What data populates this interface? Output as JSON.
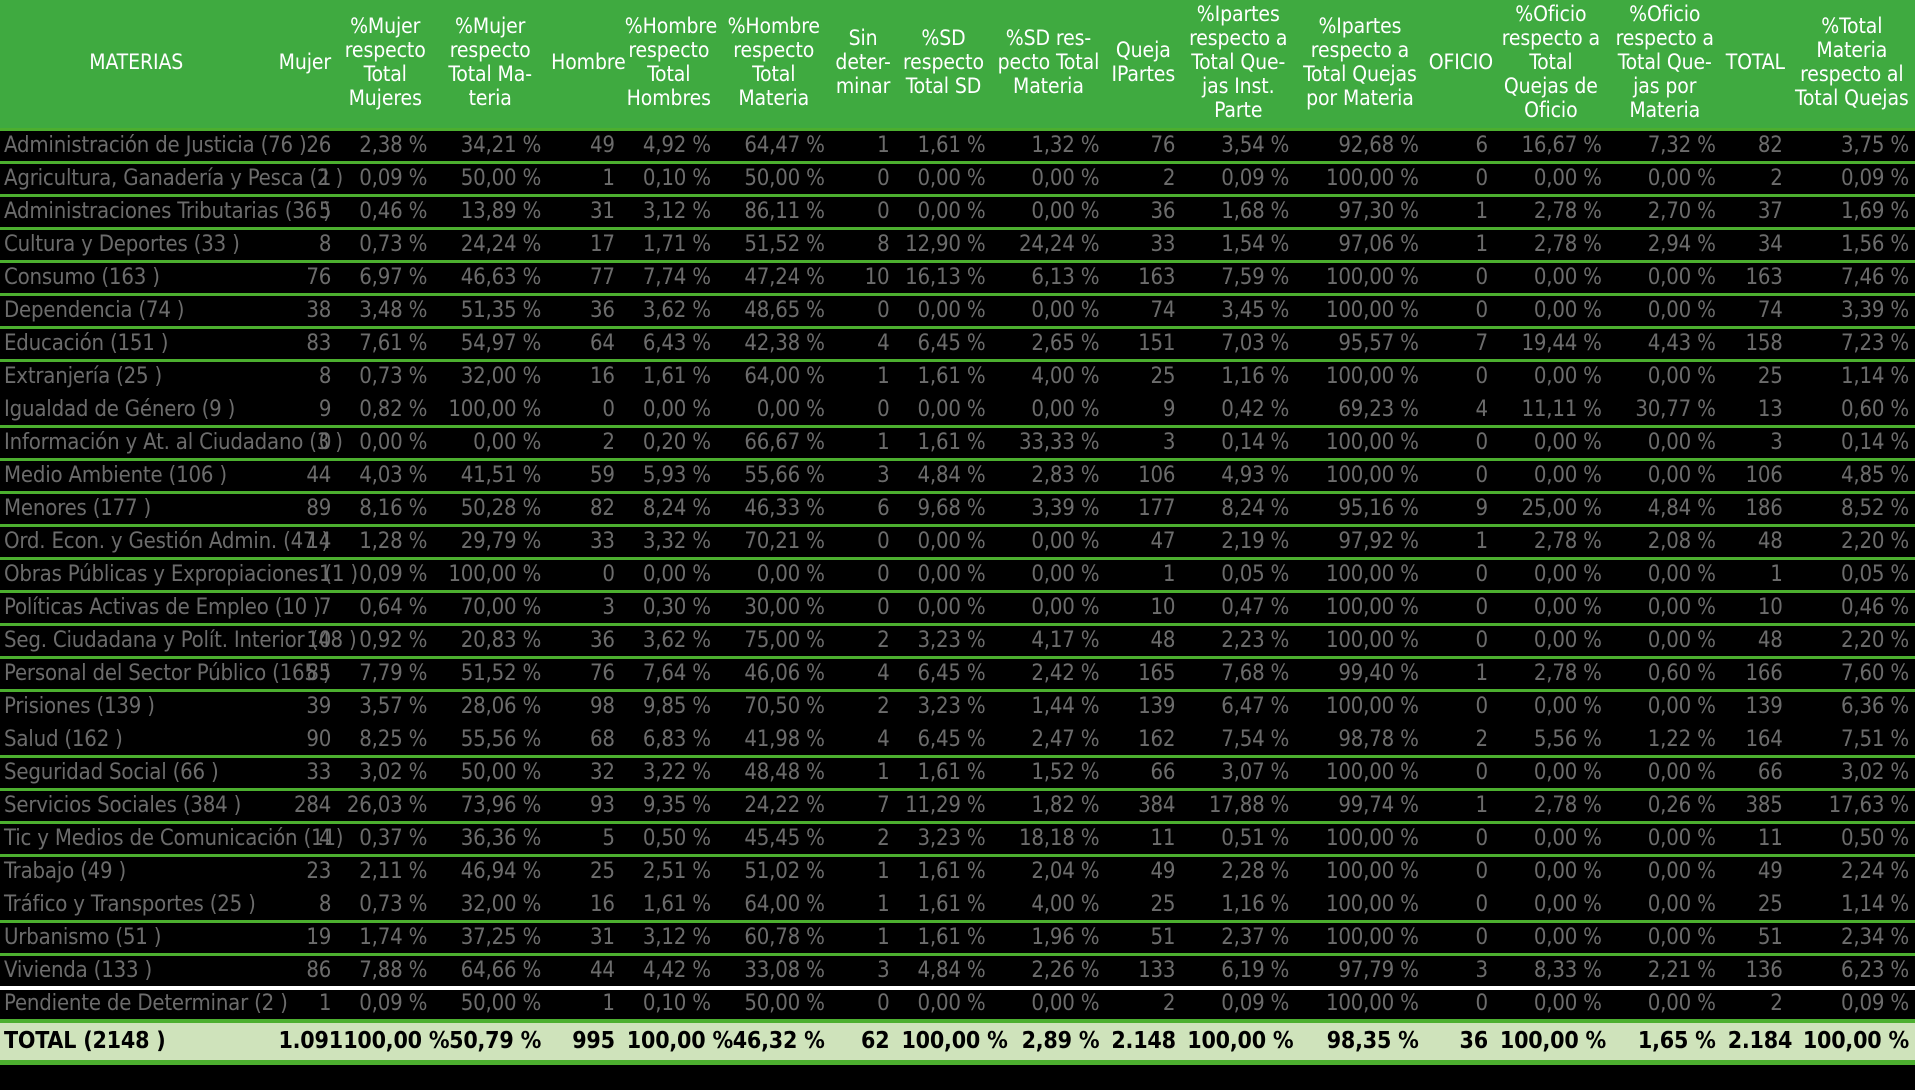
{
  "table": {
    "columns": [
      "MATERIAS",
      "Mujer",
      "%Mujer respecto Total Mujeres",
      "%Mujer respecto Total Ma-teria",
      "Hombre",
      "%Hombre respecto Total Hombres",
      "%Hombre respecto Total Materia",
      "Sin deter-minar",
      "%SD respecto Total SD",
      "%SD res-pecto Total Materia",
      "Queja IPartes",
      "%Ipartes respecto a Total Que-jas Inst. Parte",
      "%Ipartes respecto a Total Quejas por Materia",
      "OFICIO",
      "%Oficio respecto a Total Quejas de Oficio",
      "%Oficio respecto a Total Que-jas por Materia",
      "TOTAL",
      "%Total Materia respecto al Total Quejas"
    ],
    "rows": [
      [
        "Administración de Justicia (76 )",
        "26",
        "2,38 %",
        "34,21 %",
        "49",
        "4,92 %",
        "64,47 %",
        "1",
        "1,61 %",
        "1,32 %",
        "76",
        "3,54 %",
        "92,68 %",
        "6",
        "16,67 %",
        "7,32 %",
        "82",
        "3,75 %"
      ],
      [
        "Agricultura, Ganadería y Pesca (2 )",
        "1",
        "0,09 %",
        "50,00 %",
        "1",
        "0,10 %",
        "50,00 %",
        "0",
        "0,00 %",
        "0,00 %",
        "2",
        "0,09 %",
        "100,00 %",
        "0",
        "0,00 %",
        "0,00 %",
        "2",
        "0,09 %"
      ],
      [
        "Administraciones Tributarias (36 )",
        "5",
        "0,46 %",
        "13,89 %",
        "31",
        "3,12 %",
        "86,11 %",
        "0",
        "0,00 %",
        "0,00 %",
        "36",
        "1,68 %",
        "97,30 %",
        "1",
        "2,78 %",
        "2,70 %",
        "37",
        "1,69 %"
      ],
      [
        "Cultura y Deportes (33 )",
        "8",
        "0,73 %",
        "24,24 %",
        "17",
        "1,71 %",
        "51,52 %",
        "8",
        "12,90 %",
        "24,24 %",
        "33",
        "1,54 %",
        "97,06 %",
        "1",
        "2,78 %",
        "2,94 %",
        "34",
        "1,56 %"
      ],
      [
        "Consumo (163 )",
        "76",
        "6,97 %",
        "46,63 %",
        "77",
        "7,74 %",
        "47,24 %",
        "10",
        "16,13 %",
        "6,13 %",
        "163",
        "7,59 %",
        "100,00 %",
        "0",
        "0,00 %",
        "0,00 %",
        "163",
        "7,46 %"
      ],
      [
        "Dependencia (74 )",
        "38",
        "3,48 %",
        "51,35 %",
        "36",
        "3,62 %",
        "48,65 %",
        "0",
        "0,00 %",
        "0,00 %",
        "74",
        "3,45 %",
        "100,00 %",
        "0",
        "0,00 %",
        "0,00 %",
        "74",
        "3,39 %"
      ],
      [
        "Educación (151 )",
        "83",
        "7,61 %",
        "54,97 %",
        "64",
        "6,43 %",
        "42,38 %",
        "4",
        "6,45 %",
        "2,65 %",
        "151",
        "7,03 %",
        "95,57 %",
        "7",
        "19,44 %",
        "4,43 %",
        "158",
        "7,23 %"
      ],
      [
        "Extranjería (25 )",
        "8",
        "0,73 %",
        "32,00 %",
        "16",
        "1,61 %",
        "64,00 %",
        "1",
        "1,61 %",
        "4,00 %",
        "25",
        "1,16 %",
        "100,00 %",
        "0",
        "0,00 %",
        "0,00 %",
        "25",
        "1,14 %"
      ],
      [
        "Igualdad de Género (9 )",
        "9",
        "0,82 %",
        "100,00 %",
        "0",
        "0,00 %",
        "0,00 %",
        "0",
        "0,00 %",
        "0,00 %",
        "9",
        "0,42 %",
        "69,23 %",
        "4",
        "11,11 %",
        "30,77 %",
        "13",
        "0,60 %"
      ],
      [
        "Información y At. al Ciudadano (3 )",
        "0",
        "0,00 %",
        "0,00 %",
        "2",
        "0,20 %",
        "66,67 %",
        "1",
        "1,61 %",
        "33,33 %",
        "3",
        "0,14 %",
        "100,00 %",
        "0",
        "0,00 %",
        "0,00 %",
        "3",
        "0,14 %"
      ],
      [
        "Medio Ambiente (106 )",
        "44",
        "4,03 %",
        "41,51 %",
        "59",
        "5,93 %",
        "55,66 %",
        "3",
        "4,84 %",
        "2,83 %",
        "106",
        "4,93 %",
        "100,00 %",
        "0",
        "0,00 %",
        "0,00 %",
        "106",
        "4,85 %"
      ],
      [
        "Menores (177 )",
        "89",
        "8,16 %",
        "50,28 %",
        "82",
        "8,24 %",
        "46,33 %",
        "6",
        "9,68 %",
        "3,39 %",
        "177",
        "8,24 %",
        "95,16 %",
        "9",
        "25,00 %",
        "4,84 %",
        "186",
        "8,52 %"
      ],
      [
        "Ord. Econ. y Gestión Admin. (47 )",
        "14",
        "1,28 %",
        "29,79 %",
        "33",
        "3,32 %",
        "70,21 %",
        "0",
        "0,00 %",
        "0,00 %",
        "47",
        "2,19 %",
        "97,92 %",
        "1",
        "2,78 %",
        "2,08 %",
        "48",
        "2,20 %"
      ],
      [
        "Obras Públicas y Expropiaciones (1 )",
        "1",
        "0,09 %",
        "100,00 %",
        "0",
        "0,00 %",
        "0,00 %",
        "0",
        "0,00 %",
        "0,00 %",
        "1",
        "0,05 %",
        "100,00 %",
        "0",
        "0,00 %",
        "0,00 %",
        "1",
        "0,05 %"
      ],
      [
        "Políticas Activas de Empleo (10 )",
        "7",
        "0,64 %",
        "70,00 %",
        "3",
        "0,30 %",
        "30,00 %",
        "0",
        "0,00 %",
        "0,00 %",
        "10",
        "0,47 %",
        "100,00 %",
        "0",
        "0,00 %",
        "0,00 %",
        "10",
        "0,46 %"
      ],
      [
        "Seg. Ciudadana y Polít. Interior (48 )",
        "10",
        "0,92 %",
        "20,83 %",
        "36",
        "3,62 %",
        "75,00 %",
        "2",
        "3,23 %",
        "4,17 %",
        "48",
        "2,23 %",
        "100,00 %",
        "0",
        "0,00 %",
        "0,00 %",
        "48",
        "2,20 %"
      ],
      [
        "Personal del Sector Público (165 )",
        "85",
        "7,79 %",
        "51,52 %",
        "76",
        "7,64 %",
        "46,06 %",
        "4",
        "6,45 %",
        "2,42 %",
        "165",
        "7,68 %",
        "99,40 %",
        "1",
        "2,78 %",
        "0,60 %",
        "166",
        "7,60 %"
      ],
      [
        "Prisiones (139 )",
        "39",
        "3,57 %",
        "28,06 %",
        "98",
        "9,85 %",
        "70,50 %",
        "2",
        "3,23 %",
        "1,44 %",
        "139",
        "6,47 %",
        "100,00 %",
        "0",
        "0,00 %",
        "0,00 %",
        "139",
        "6,36 %"
      ],
      [
        "Salud (162 )",
        "90",
        "8,25 %",
        "55,56 %",
        "68",
        "6,83 %",
        "41,98 %",
        "4",
        "6,45 %",
        "2,47 %",
        "162",
        "7,54 %",
        "98,78 %",
        "2",
        "5,56 %",
        "1,22 %",
        "164",
        "7,51 %"
      ],
      [
        "Seguridad Social (66 )",
        "33",
        "3,02 %",
        "50,00 %",
        "32",
        "3,22 %",
        "48,48 %",
        "1",
        "1,61 %",
        "1,52 %",
        "66",
        "3,07 %",
        "100,00 %",
        "0",
        "0,00 %",
        "0,00 %",
        "66",
        "3,02 %"
      ],
      [
        "Servicios Sociales (384 )",
        "284",
        "26,03 %",
        "73,96 %",
        "93",
        "9,35 %",
        "24,22 %",
        "7",
        "11,29 %",
        "1,82 %",
        "384",
        "17,88 %",
        "99,74 %",
        "1",
        "2,78 %",
        "0,26 %",
        "385",
        "17,63 %"
      ],
      [
        "Tic y Medios de Comunicación (11)",
        "4",
        "0,37 %",
        "36,36 %",
        "5",
        "0,50 %",
        "45,45 %",
        "2",
        "3,23 %",
        "18,18 %",
        "11",
        "0,51 %",
        "100,00 %",
        "0",
        "0,00 %",
        "0,00 %",
        "11",
        "0,50 %"
      ],
      [
        "Trabajo (49 )",
        "23",
        "2,11 %",
        "46,94 %",
        "25",
        "2,51 %",
        "51,02 %",
        "1",
        "1,61 %",
        "2,04 %",
        "49",
        "2,28 %",
        "100,00 %",
        "0",
        "0,00 %",
        "0,00 %",
        "49",
        "2,24 %"
      ],
      [
        "Tráfico y Transportes (25 )",
        "8",
        "0,73 %",
        "32,00 %",
        "16",
        "1,61 %",
        "64,00 %",
        "1",
        "1,61 %",
        "4,00 %",
        "25",
        "1,16 %",
        "100,00 %",
        "0",
        "0,00 %",
        "0,00 %",
        "25",
        "1,14 %"
      ],
      [
        "Urbanismo (51 )",
        "19",
        "1,74 %",
        "37,25 %",
        "31",
        "3,12 %",
        "60,78 %",
        "1",
        "1,61 %",
        "1,96 %",
        "51",
        "2,37 %",
        "100,00 %",
        "0",
        "0,00 %",
        "0,00 %",
        "51",
        "2,34 %"
      ],
      [
        "Vivienda (133 )",
        "86",
        "7,88 %",
        "64,66 %",
        "44",
        "4,42 %",
        "33,08 %",
        "3",
        "4,84 %",
        "2,26 %",
        "133",
        "6,19 %",
        "97,79 %",
        "3",
        "8,33 %",
        "2,21 %",
        "136",
        "6,23 %"
      ],
      [
        "Pendiente de Determinar (2 )",
        "1",
        "0,09 %",
        "50,00 %",
        "1",
        "0,10 %",
        "50,00 %",
        "0",
        "0,00 %",
        "0,00 %",
        "2",
        "0,09 %",
        "100,00 %",
        "0",
        "0,00 %",
        "0,00 %",
        "2",
        "0,09 %"
      ]
    ],
    "total_row": [
      "TOTAL (2148 )",
      "1.091",
      "100,00 %",
      "50,79 %",
      "995",
      "100,00 %",
      "46,32 %",
      "62",
      "100,00 %",
      "2,89 %",
      "2.148",
      "100,00 %",
      "98,35 %",
      "36",
      "100,00 %",
      "1,65 %",
      "2.184",
      "100,00 %"
    ]
  },
  "colors": {
    "header_green": "#3faa40",
    "rule_green": "#4caf2f",
    "total_bg": "#cfe3bb",
    "body_bg": "#000000",
    "body_text": "#6c6c6c"
  }
}
